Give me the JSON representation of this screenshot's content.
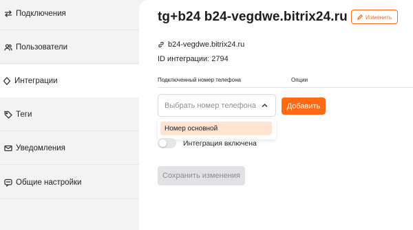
{
  "sidebar": {
    "items": [
      {
        "label": "Подключения",
        "icon": "connections-icon"
      },
      {
        "label": "Пользователи",
        "icon": "users-icon"
      },
      {
        "label": "Интеграции",
        "icon": "integrations-icon",
        "active": true
      },
      {
        "label": "Теги",
        "icon": "tag-icon"
      },
      {
        "label": "Уведомления",
        "icon": "mail-icon"
      },
      {
        "label": "Общие настройки",
        "icon": "chat-settings-icon"
      }
    ]
  },
  "header": {
    "title": "tg+b24 b24-vegdwe.bitrix24.ru",
    "edit_label": "Изменить"
  },
  "details": {
    "domain": "b24-vegdwe.bitrix24.ru",
    "integration_id": "ID интеграции: 2794"
  },
  "table": {
    "col_phone": "Подключенный номер телефона",
    "col_options": "Опции"
  },
  "phone_select": {
    "placeholder": "Выбрать номер телефона",
    "options": [
      "Номер основной"
    ]
  },
  "add_label": "Добавить",
  "toggle": {
    "label": "Интеграция включена",
    "enabled": false
  },
  "save_label": "Сохранить изменения",
  "colors": {
    "accent": "#ff6a13",
    "highlight": "#ffe3d3",
    "sidebar_bg": "#f3f3f4"
  }
}
